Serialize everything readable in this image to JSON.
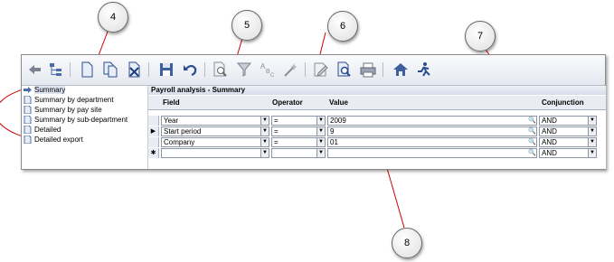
{
  "callouts": {
    "c4": "4",
    "c5": "5",
    "c6": "6",
    "c7": "7",
    "c8": "8"
  },
  "toolbar": {
    "icons": [
      "back-icon",
      "tree-icon",
      "new-document-icon",
      "copy-document-icon",
      "delete-document-icon",
      "save-icon",
      "undo-icon",
      "search-document-icon",
      "filter-icon",
      "abc-sort-icon",
      "wand-icon",
      "edit-document-icon",
      "query-icon",
      "print-icon",
      "home-icon",
      "exit-icon"
    ]
  },
  "tree": {
    "items": [
      {
        "label": "Summary",
        "selected": true
      },
      {
        "label": "Summary by department"
      },
      {
        "label": "Summary by pay site"
      },
      {
        "label": "Summary by sub-department"
      },
      {
        "label": "Detailed"
      },
      {
        "label": "Detailed export"
      }
    ]
  },
  "grid": {
    "title": "Payroll analysis - Summary",
    "columns": {
      "field": "Field",
      "operator": "Operator",
      "value": "Value",
      "conjunction": "Conjunction"
    },
    "rows": [
      {
        "field": "Year",
        "operator": "=",
        "value": "2009",
        "conjunction": "AND",
        "marker": ""
      },
      {
        "field": "Start period",
        "operator": "=",
        "value": "9",
        "conjunction": "AND",
        "marker": "▶"
      },
      {
        "field": "Company",
        "operator": "=",
        "value": "01",
        "conjunction": "AND",
        "marker": ""
      },
      {
        "field": "",
        "operator": "",
        "value": "",
        "conjunction": "AND",
        "marker": "✱"
      }
    ]
  },
  "colors": {
    "accent": "#cc0000",
    "toolbar": "#e4e8ef",
    "header": "#e9edf3"
  }
}
